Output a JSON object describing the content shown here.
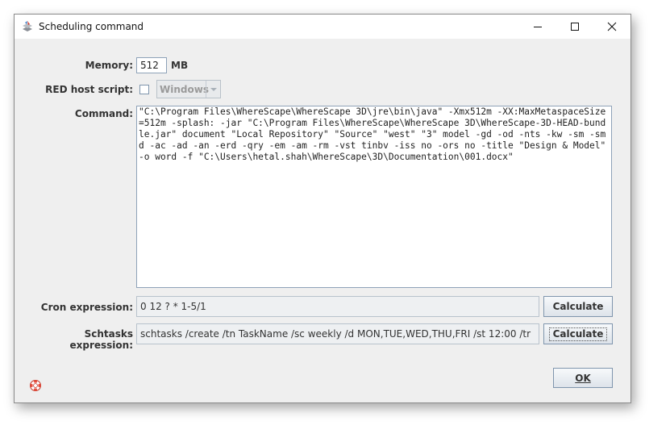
{
  "window": {
    "title": "Scheduling command",
    "app_icon": "wherescape-icon"
  },
  "titlebar_buttons": {
    "minimize": "minimize-icon",
    "maximize": "maximize-icon",
    "close": "close-icon"
  },
  "memory": {
    "label": "Memory:",
    "value": "512",
    "unit": "MB"
  },
  "red_host_script": {
    "label": "RED host script:",
    "checked": false,
    "dropdown_value": "Windows"
  },
  "command": {
    "label": "Command:",
    "value": "\"C:\\Program Files\\WhereScape\\WhereScape 3D\\jre\\bin\\java\" -Xmx512m -XX:MaxMetaspaceSize=512m -splash: -jar \"C:\\Program Files\\WhereScape\\WhereScape 3D\\WhereScape-3D-HEAD-bundle.jar\" document \"Local Repository\" \"Source\" \"west\" \"3\" model -gd -od -nts -kw -sm -smd -ac -ad -an -erd -qry -em -am -rm -vst tinbv -iss no -ors no -title \"Design & Model\" -o word -f \"C:\\Users\\hetal.shah\\WhereScape\\3D\\Documentation\\001.docx\""
  },
  "cron": {
    "label": "Cron expression:",
    "value": "0 12 ? * 1-5/1",
    "button_label": "Calculate"
  },
  "schtasks": {
    "label": "Schtasks expression:",
    "value": "schtasks /create /tn TaskName /sc weekly /d MON,TUE,WED,THU,FRI /st 12:00 /tr",
    "button_label": "Calculate"
  },
  "ok_button": {
    "label": "OK"
  },
  "help": {
    "icon": "lifebuoy-help-icon"
  }
}
